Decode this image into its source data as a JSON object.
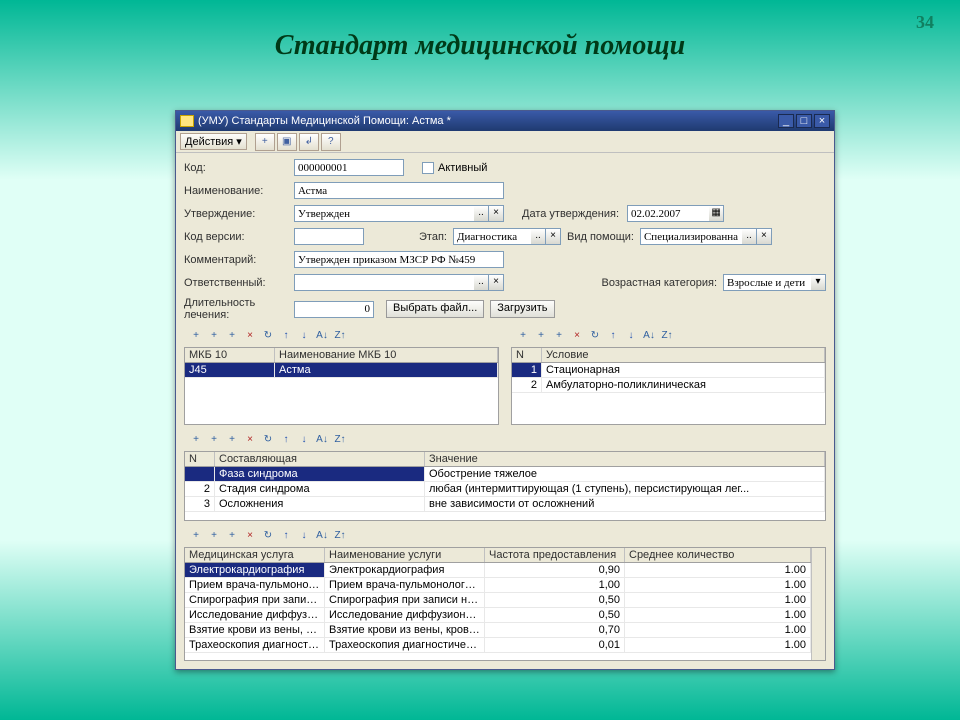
{
  "page_number": "34",
  "slide_title": "Стандарт медицинской помощи",
  "window": {
    "title": "(УМУ) Стандарты Медицинской Помощи: Астма *",
    "min": "_",
    "max": "□",
    "close": "×"
  },
  "menu": {
    "actions": "Действия ▾"
  },
  "toolbar_icons": [
    "+",
    "▣",
    "↲",
    "?"
  ],
  "form": {
    "code_label": "Код:",
    "code_value": "000000001",
    "active_label": "Активный",
    "name_label": "Наименование:",
    "name_value": "Астма",
    "approved_label": "Утверждение:",
    "approved_value": "Утвержден",
    "date_label": "Дата утверждения:",
    "date_value": "02.02.2007",
    "version_label": "Код версии:",
    "version_value": "",
    "stage_label": "Этап:",
    "stage_value": "Диагностика",
    "care_kind_label": "Вид помощи:",
    "care_kind_value": "Специализированна",
    "comment_label": "Комментарий:",
    "comment_value": "Утвержден приказом МЗСР РФ №459",
    "responsible_label": "Ответственный:",
    "responsible_value": "",
    "age_cat_label": "Возрастная категория:",
    "age_cat_value": "Взрослые и дети",
    "duration_label": "Длительность лечения:",
    "duration_value": "0",
    "select_file_btn": "Выбрать файл...",
    "load_btn": "Загрузить"
  },
  "grid1": {
    "headers": [
      "МКБ 10",
      "Наименование МКБ 10"
    ],
    "rows": [
      {
        "code": "J45",
        "name": "Астма",
        "selected": true
      }
    ]
  },
  "grid2": {
    "headers": [
      "N",
      "Условие"
    ],
    "rows": [
      {
        "n": "1",
        "cond": "Стационарная",
        "selected": true
      },
      {
        "n": "2",
        "cond": "Амбулаторно-поликлиническая"
      }
    ]
  },
  "grid3": {
    "headers": [
      "N",
      "Составляющая",
      "Значение"
    ],
    "rows": [
      {
        "n": "",
        "comp": "Фаза синдрома",
        "val": "Обострение тяжелое",
        "selected": true
      },
      {
        "n": "2",
        "comp": "Стадия синдрома",
        "val": "любая (интермиттирующая (1 ступень), персистирующая лег..."
      },
      {
        "n": "3",
        "comp": "Осложнения",
        "val": "вне зависимости от осложнений"
      }
    ]
  },
  "grid4": {
    "headers": [
      "Медицинская услуга",
      "Наименование услуги",
      "Частота предоставления",
      "Среднее количество"
    ],
    "rows": [
      {
        "svc": "Электрокардиография",
        "name": "Электрокардиография",
        "freq": "0,90",
        "qty": "1.00",
        "selected": true
      },
      {
        "svc": "Прием врача-пульмонолога п...",
        "name": "Прием врача-пульмонолога, пе...",
        "freq": "1,00",
        "qty": "1.00"
      },
      {
        "svc": "Спирография при записи на авт...",
        "name": "Спирография при записи на авт...",
        "freq": "0,50",
        "qty": "1.00"
      },
      {
        "svc": "Исследование диффузионной с...",
        "name": "Исследование диффузионной с...",
        "freq": "0,50",
        "qty": "1.00"
      },
      {
        "svc": "Взятие крови из вены, кровопу...",
        "name": "Взятие крови из вены, кровопу...",
        "freq": "0,70",
        "qty": "1.00"
      },
      {
        "svc": "Трахеоскопия диагностическая",
        "name": "Трахеоскопия диагностическая",
        "freq": "0,01",
        "qty": "1.00"
      }
    ]
  },
  "panel_icons": [
    "+",
    "+",
    "+",
    "×",
    "↻",
    "↑",
    "↓",
    "A↓",
    "Z↑"
  ]
}
